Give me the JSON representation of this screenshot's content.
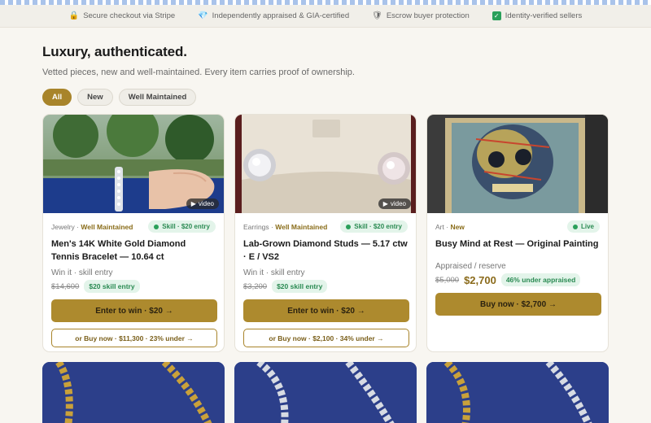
{
  "trust_bar": [
    {
      "icon": "lock-icon",
      "label": "Secure checkout via Stripe"
    },
    {
      "icon": "gem-icon",
      "label": "Independently appraised & GIA-certified"
    },
    {
      "icon": "shield-icon",
      "label": "Escrow buyer protection"
    },
    {
      "icon": "check-icon",
      "label": "Identity-verified sellers"
    }
  ],
  "hero": {
    "title": "Luxury, authenticated.",
    "subtitle": "Vetted pieces, new and well-maintained. Every item carries proof of ownership."
  },
  "filters": [
    "All",
    "New",
    "Well Maintained"
  ],
  "active_filter": "All",
  "cards": [
    {
      "category": "Jewelry",
      "condition": "Well Maintained",
      "status": "Skill · $20 entry",
      "title": "Men's 14K White Gold Diamond Tennis Bracelet — 10.64 ct",
      "mode": "Win it · skill entry",
      "original_price": "$14,600",
      "badge": "$20 skill entry",
      "primary_cta": "Enter to win · $20 →",
      "secondary_cta": "or Buy now · $11,300 · 23% under →",
      "video_label": "video"
    },
    {
      "category": "Earrings",
      "condition": "Well Maintained",
      "status": "Skill · $20 entry",
      "title": "Lab-Grown Diamond Studs — 5.17 ctw · E / VS2",
      "mode": "Win it · skill entry",
      "original_price": "$3,200",
      "badge": "$20 skill entry",
      "primary_cta": "Enter to win · $20 →",
      "secondary_cta": "or Buy now · $2,100 · 34% under →",
      "video_label": "video"
    },
    {
      "category": "Art",
      "condition": "New",
      "status": "Live",
      "title": "Busy Mind at Rest — Original Painting",
      "mode": "Appraised / reserve",
      "original_price": "$5,000",
      "price": "$2,700",
      "badge": "46% under appraised",
      "primary_cta": "Buy now · $2,700 →"
    }
  ],
  "colors": {
    "accent": "#ad8a2e",
    "background": "#f8f6f1",
    "success": "#2a8a52"
  }
}
